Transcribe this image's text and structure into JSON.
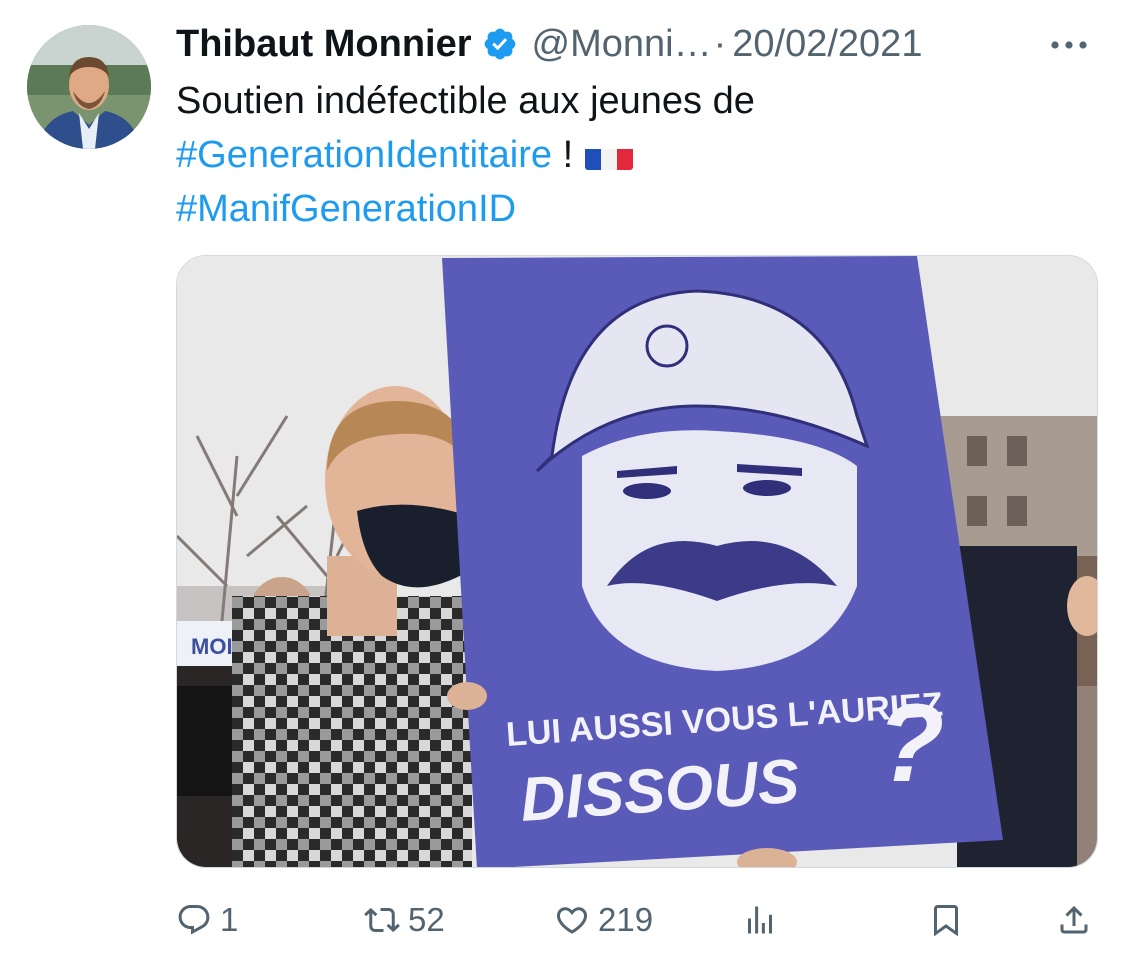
{
  "tweet": {
    "author_name": "Thibaut Monnier",
    "handle": "@Monni…",
    "separator": "·",
    "date": "20/02/2021",
    "text_line1": "Soutien indéfectible aux jeunes de",
    "hashtag1": "#GenerationIdentitaire",
    "exclaim": " !",
    "hashtag2": "#ManifGenerationID",
    "flag_icon": "flag-france-icon",
    "verified_icon": "verified-badge-icon"
  },
  "media": {
    "sign_line1": "LUI AUSSI VOUS L'AURIEZ",
    "sign_line2": "DISSOUS",
    "sign_mark": "?",
    "background_sign_text": "MOI"
  },
  "actions": {
    "reply_count": "1",
    "retweet_count": "52",
    "like_count": "219",
    "icons": [
      "reply-icon",
      "retweet-icon",
      "like-icon",
      "views-icon",
      "bookmark-icon",
      "share-icon"
    ]
  },
  "colors": {
    "link": "#1d9bf0",
    "secondary_text": "#536471",
    "primary_text": "#0f1419",
    "sign_purple": "#5a5ab8"
  }
}
